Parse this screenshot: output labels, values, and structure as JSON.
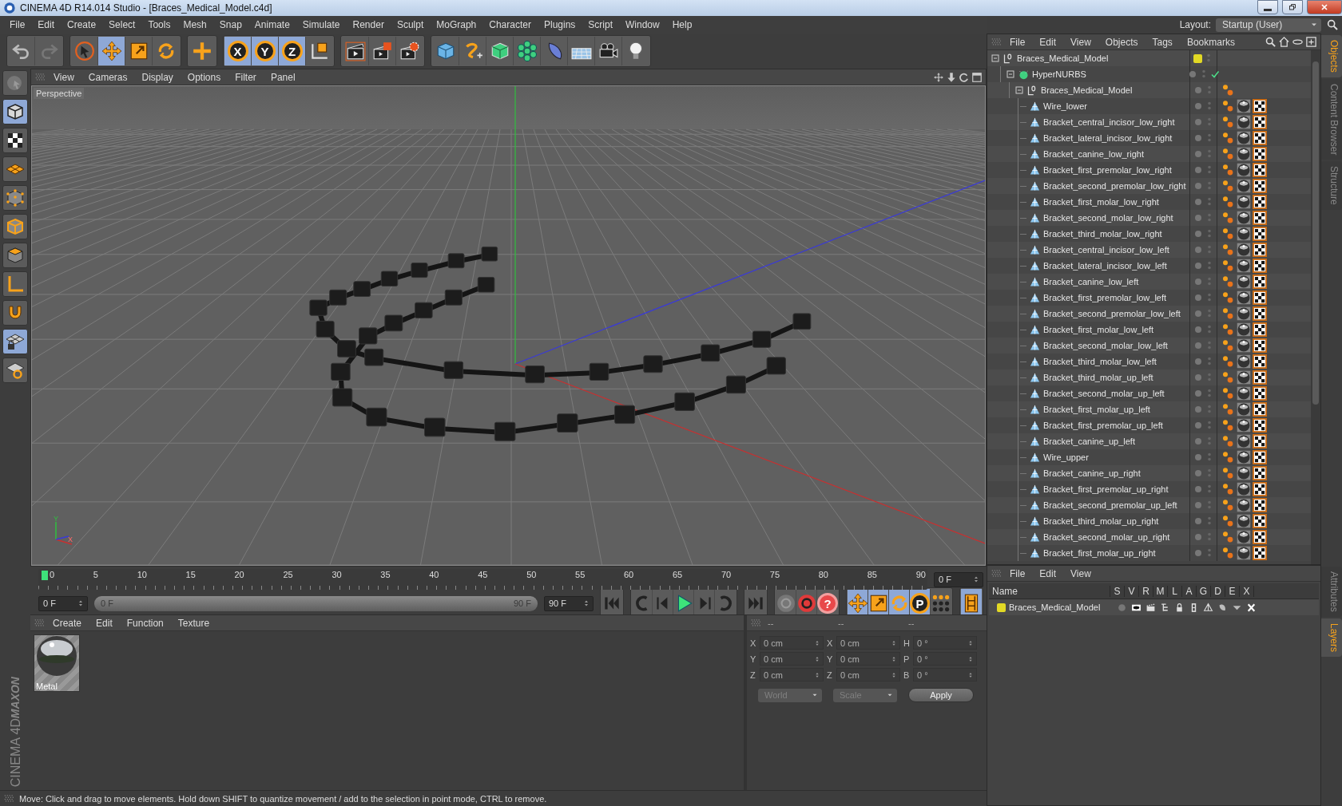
{
  "window": {
    "title": "CINEMA 4D R14.014 Studio - [Braces_Medical_Model.c4d]"
  },
  "menu": [
    "File",
    "Edit",
    "Create",
    "Select",
    "Tools",
    "Mesh",
    "Snap",
    "Animate",
    "Simulate",
    "Render",
    "Sculpt",
    "MoGraph",
    "Character",
    "Plugins",
    "Script",
    "Window",
    "Help"
  ],
  "layout": {
    "label": "Layout:",
    "value": "Startup (User)"
  },
  "toolbar": [
    [
      {
        "kind": "undo",
        "selected": false
      },
      {
        "kind": "redo",
        "selected": false
      }
    ],
    [
      {
        "kind": "select",
        "selected": false
      },
      {
        "kind": "move",
        "selected": true
      },
      {
        "kind": "scale",
        "selected": false
      },
      {
        "kind": "rotate",
        "selected": false
      }
    ],
    [
      {
        "kind": "add",
        "selected": false
      }
    ],
    [
      {
        "kind": "axis",
        "label": "X",
        "selected": true
      },
      {
        "kind": "axis",
        "label": "Y",
        "selected": true
      },
      {
        "kind": "axis",
        "label": "Z",
        "selected": true
      },
      {
        "kind": "coord",
        "selected": false
      }
    ],
    [
      {
        "kind": "render-view",
        "selected": false
      },
      {
        "kind": "render-picture",
        "selected": false
      },
      {
        "kind": "render-settings",
        "selected": false
      }
    ],
    [
      {
        "kind": "cube",
        "selected": false
      },
      {
        "kind": "spline",
        "selected": false
      },
      {
        "kind": "nurbs",
        "selected": false
      },
      {
        "kind": "cloner",
        "selected": false
      },
      {
        "kind": "deformer",
        "selected": false
      },
      {
        "kind": "floor",
        "selected": false
      },
      {
        "kind": "camera",
        "selected": false
      },
      {
        "kind": "light",
        "selected": false
      }
    ]
  ],
  "left_tools": [
    {
      "kind": "tweak",
      "selected": false
    },
    {
      "kind": "model",
      "selected": true
    },
    {
      "kind": "texture",
      "selected": false
    },
    {
      "kind": "workplane",
      "selected": false
    },
    {
      "kind": "points",
      "selected": false
    },
    {
      "kind": "edges",
      "selected": false
    },
    {
      "kind": "polygons",
      "selected": false
    },
    {
      "kind": "axis-mode",
      "selected": false
    },
    {
      "kind": "magnet",
      "selected": false
    },
    {
      "kind": "gridlock",
      "selected": true
    },
    {
      "kind": "gridrot",
      "selected": false
    }
  ],
  "brand": [
    "MAXON",
    "CINEMA 4D"
  ],
  "viewport": {
    "menu": [
      "View",
      "Cameras",
      "Display",
      "Options",
      "Filter",
      "Panel"
    ],
    "label": "Perspective",
    "gizmo": [
      "Y",
      "X"
    ]
  },
  "timeline": {
    "ticks": [
      "0",
      "5",
      "10",
      "15",
      "20",
      "25",
      "30",
      "35",
      "40",
      "45",
      "50",
      "55",
      "60",
      "65",
      "70",
      "75",
      "80",
      "85",
      "90"
    ],
    "level": 0,
    "current": "0 F",
    "start": "0 F",
    "range": {
      "start": "0 F",
      "end": "90 F",
      "level": 1
    },
    "end": "90 F"
  },
  "transport": [
    [
      {
        "kind": "go-start",
        "selected": false
      }
    ],
    [
      {
        "kind": "prev-key",
        "selected": false
      },
      {
        "kind": "step-back",
        "selected": false
      },
      {
        "kind": "play",
        "selected": false
      },
      {
        "kind": "step-fwd",
        "selected": false
      },
      {
        "kind": "next-key",
        "selected": false
      }
    ],
    [
      {
        "kind": "go-end",
        "selected": false
      }
    ],
    [
      {
        "kind": "record-off",
        "selected": false
      },
      {
        "kind": "record",
        "selected": false
      },
      {
        "kind": "help",
        "label": "?",
        "selected": false
      }
    ],
    [
      {
        "kind": "move",
        "selected": true
      },
      {
        "kind": "scale",
        "selected": true
      },
      {
        "kind": "rotate",
        "selected": true
      },
      {
        "kind": "param",
        "label": "P",
        "selected": true
      },
      {
        "kind": "dots",
        "selected": false
      }
    ],
    [
      {
        "kind": "film",
        "selected": true
      }
    ]
  ],
  "materials": {
    "menu": [
      "Create",
      "Edit",
      "Function",
      "Texture"
    ],
    "items": [
      {
        "name": "Metal"
      }
    ]
  },
  "coordinates": {
    "headers": [
      "--",
      "--",
      "--"
    ],
    "rows": [
      [
        {
          "label": "X",
          "value": "0 cm"
        },
        {
          "label": "X",
          "value": "0 cm"
        },
        {
          "label": "H",
          "value": "0 °"
        }
      ],
      [
        {
          "label": "Y",
          "value": "0 cm"
        },
        {
          "label": "Y",
          "value": "0 cm"
        },
        {
          "label": "P",
          "value": "0 °"
        }
      ],
      [
        {
          "label": "Z",
          "value": "0 cm"
        },
        {
          "label": "Z",
          "value": "0 cm"
        },
        {
          "label": "B",
          "value": "0 °"
        }
      ]
    ],
    "dropdowns": [
      {
        "value": "World",
        "disabled": true
      },
      {
        "value": "Scale",
        "disabled": true
      }
    ],
    "apply": "Apply"
  },
  "status": "Move: Click and drag to move elements. Hold down SHIFT to quantize movement / add to the selection in point mode, CTRL to remove.",
  "objects": {
    "menu": [
      "File",
      "Edit",
      "View",
      "Objects",
      "Tags",
      "Bookmarks"
    ],
    "tree": [
      {
        "name": "Braces_Medical_Model",
        "kind": "null",
        "color": "#e2d925",
        "expanded": true,
        "children": [
          {
            "name": "HyperNURBS",
            "kind": "nurbs",
            "enabled": true,
            "expanded": true,
            "children": [
              {
                "name": "Braces_Medical_Model",
                "kind": "null",
                "expanded": true,
                "tags": [
                  {
                    "kind": "phong"
                  }
                ],
                "children": [
                  {
                    "name": "Wire_lower",
                    "kind": "polygon",
                    "tags": [
                      {
                        "kind": "phong"
                      },
                      {
                        "kind": "material"
                      },
                      {
                        "kind": "uvw"
                      }
                    ]
                  },
                  {
                    "name": "Bracket_central_incisor_low_right",
                    "kind": "polygon",
                    "tags": [
                      {
                        "kind": "phong"
                      },
                      {
                        "kind": "material"
                      },
                      {
                        "kind": "uvw"
                      }
                    ]
                  },
                  {
                    "name": "Bracket_lateral_incisor_low_right",
                    "kind": "polygon",
                    "tags": [
                      {
                        "kind": "phong"
                      },
                      {
                        "kind": "material"
                      },
                      {
                        "kind": "uvw"
                      }
                    ]
                  },
                  {
                    "name": "Bracket_canine_low_right",
                    "kind": "polygon",
                    "tags": [
                      {
                        "kind": "phong"
                      },
                      {
                        "kind": "material"
                      },
                      {
                        "kind": "uvw"
                      }
                    ]
                  },
                  {
                    "name": "Bracket_first_premolar_low_right",
                    "kind": "polygon",
                    "tags": [
                      {
                        "kind": "phong"
                      },
                      {
                        "kind": "material"
                      },
                      {
                        "kind": "uvw"
                      }
                    ]
                  },
                  {
                    "name": "Bracket_second_premolar_low_right",
                    "kind": "polygon",
                    "tags": [
                      {
                        "kind": "phong"
                      },
                      {
                        "kind": "material"
                      },
                      {
                        "kind": "uvw"
                      }
                    ]
                  },
                  {
                    "name": "Bracket_first_molar_low_right",
                    "kind": "polygon",
                    "tags": [
                      {
                        "kind": "phong"
                      },
                      {
                        "kind": "material"
                      },
                      {
                        "kind": "uvw"
                      }
                    ]
                  },
                  {
                    "name": "Bracket_second_molar_low_right",
                    "kind": "polygon",
                    "tags": [
                      {
                        "kind": "phong"
                      },
                      {
                        "kind": "material"
                      },
                      {
                        "kind": "uvw"
                      }
                    ]
                  },
                  {
                    "name": "Bracket_third_molar_low_right",
                    "kind": "polygon",
                    "tags": [
                      {
                        "kind": "phong"
                      },
                      {
                        "kind": "material"
                      },
                      {
                        "kind": "uvw"
                      }
                    ]
                  },
                  {
                    "name": "Bracket_central_incisor_low_left",
                    "kind": "polygon",
                    "tags": [
                      {
                        "kind": "phong"
                      },
                      {
                        "kind": "material"
                      },
                      {
                        "kind": "uvw"
                      }
                    ]
                  },
                  {
                    "name": "Bracket_lateral_incisor_low_left",
                    "kind": "polygon",
                    "tags": [
                      {
                        "kind": "phong"
                      },
                      {
                        "kind": "material"
                      },
                      {
                        "kind": "uvw"
                      }
                    ]
                  },
                  {
                    "name": "Bracket_canine_low_left",
                    "kind": "polygon",
                    "tags": [
                      {
                        "kind": "phong"
                      },
                      {
                        "kind": "material"
                      },
                      {
                        "kind": "uvw"
                      }
                    ]
                  },
                  {
                    "name": "Bracket_first_premolar_low_left",
                    "kind": "polygon",
                    "tags": [
                      {
                        "kind": "phong"
                      },
                      {
                        "kind": "material"
                      },
                      {
                        "kind": "uvw"
                      }
                    ]
                  },
                  {
                    "name": "Bracket_second_premolar_low_left",
                    "kind": "polygon",
                    "tags": [
                      {
                        "kind": "phong"
                      },
                      {
                        "kind": "material"
                      },
                      {
                        "kind": "uvw"
                      }
                    ]
                  },
                  {
                    "name": "Bracket_first_molar_low_left",
                    "kind": "polygon",
                    "tags": [
                      {
                        "kind": "phong"
                      },
                      {
                        "kind": "material"
                      },
                      {
                        "kind": "uvw"
                      }
                    ]
                  },
                  {
                    "name": "Bracket_second_molar_low_left",
                    "kind": "polygon",
                    "tags": [
                      {
                        "kind": "phong"
                      },
                      {
                        "kind": "material"
                      },
                      {
                        "kind": "uvw"
                      }
                    ]
                  },
                  {
                    "name": "Bracket_third_molar_low_left",
                    "kind": "polygon",
                    "tags": [
                      {
                        "kind": "phong"
                      },
                      {
                        "kind": "material"
                      },
                      {
                        "kind": "uvw"
                      }
                    ]
                  },
                  {
                    "name": "Bracket_third_molar_up_left",
                    "kind": "polygon",
                    "tags": [
                      {
                        "kind": "phong"
                      },
                      {
                        "kind": "material"
                      },
                      {
                        "kind": "uvw"
                      }
                    ]
                  },
                  {
                    "name": "Bracket_second_molar_up_left",
                    "kind": "polygon",
                    "tags": [
                      {
                        "kind": "phong"
                      },
                      {
                        "kind": "material"
                      },
                      {
                        "kind": "uvw"
                      }
                    ]
                  },
                  {
                    "name": "Bracket_first_molar_up_left",
                    "kind": "polygon",
                    "tags": [
                      {
                        "kind": "phong"
                      },
                      {
                        "kind": "material"
                      },
                      {
                        "kind": "uvw"
                      }
                    ]
                  },
                  {
                    "name": "Bracket_first_premolar_up_left",
                    "kind": "polygon",
                    "tags": [
                      {
                        "kind": "phong"
                      },
                      {
                        "kind": "material"
                      },
                      {
                        "kind": "uvw"
                      }
                    ]
                  },
                  {
                    "name": "Bracket_canine_up_left",
                    "kind": "polygon",
                    "tags": [
                      {
                        "kind": "phong"
                      },
                      {
                        "kind": "material"
                      },
                      {
                        "kind": "uvw"
                      }
                    ]
                  },
                  {
                    "name": "Wire_upper",
                    "kind": "polygon",
                    "tags": [
                      {
                        "kind": "phong"
                      },
                      {
                        "kind": "material"
                      },
                      {
                        "kind": "uvw"
                      }
                    ]
                  },
                  {
                    "name": "Bracket_canine_up_right",
                    "kind": "polygon",
                    "tags": [
                      {
                        "kind": "phong"
                      },
                      {
                        "kind": "material"
                      },
                      {
                        "kind": "uvw"
                      }
                    ]
                  },
                  {
                    "name": "Bracket_first_premolar_up_right",
                    "kind": "polygon",
                    "tags": [
                      {
                        "kind": "phong"
                      },
                      {
                        "kind": "material"
                      },
                      {
                        "kind": "uvw"
                      }
                    ]
                  },
                  {
                    "name": "Bracket_second_premolar_up_left",
                    "kind": "polygon",
                    "tags": [
                      {
                        "kind": "phong"
                      },
                      {
                        "kind": "material"
                      },
                      {
                        "kind": "uvw"
                      }
                    ]
                  },
                  {
                    "name": "Bracket_third_molar_up_right",
                    "kind": "polygon",
                    "tags": [
                      {
                        "kind": "phong"
                      },
                      {
                        "kind": "material"
                      },
                      {
                        "kind": "uvw"
                      }
                    ]
                  },
                  {
                    "name": "Bracket_second_molar_up_right",
                    "kind": "polygon",
                    "tags": [
                      {
                        "kind": "phong"
                      },
                      {
                        "kind": "material"
                      },
                      {
                        "kind": "uvw"
                      }
                    ]
                  },
                  {
                    "name": "Bracket_first_molar_up_right",
                    "kind": "polygon",
                    "tags": [
                      {
                        "kind": "phong"
                      },
                      {
                        "kind": "material"
                      },
                      {
                        "kind": "uvw"
                      }
                    ]
                  }
                ]
              }
            ]
          }
        ]
      }
    ]
  },
  "object_tabs": [
    {
      "label": "Objects",
      "selected": true
    },
    {
      "label": "Content Browser",
      "selected": false
    },
    {
      "label": "Structure",
      "selected": false
    }
  ],
  "layers": {
    "menu": [
      "File",
      "Edit",
      "View"
    ],
    "columns": [
      "Name",
      "S",
      "V",
      "R",
      "M",
      "L",
      "A",
      "G",
      "D",
      "E",
      "X"
    ],
    "rows": [
      {
        "name": "Braces_Medical_Model",
        "color": "#e2d925"
      }
    ]
  },
  "layer_tabs": [
    {
      "label": "Attributes",
      "selected": false
    },
    {
      "label": "Layers",
      "selected": true
    }
  ]
}
